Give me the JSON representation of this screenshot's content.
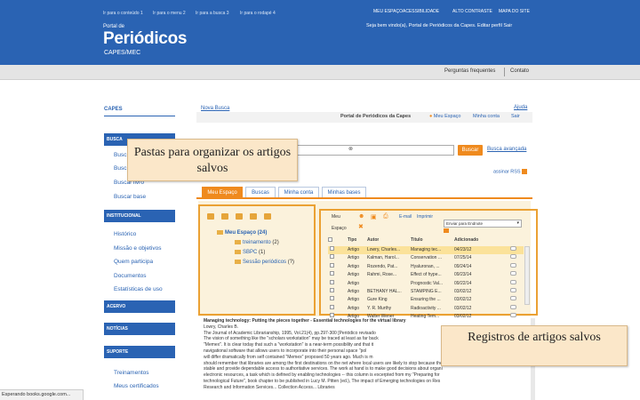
{
  "header": {
    "accessibility_links": [
      "Ir para o conteúdo 1",
      "Ir para o menu 2",
      "Ir para a busca 3",
      "Ir para o rodapé 4"
    ],
    "top_nav": [
      "MEU ESPAÇO",
      "ACESSIBILIDADE",
      "ALTO CONTRASTE",
      "MAPA DO SITE"
    ],
    "welcome": "Seja bem vindo(a), Portal de Periódicos da Capes. Editar perfil Sair",
    "brand_small": "Portal de",
    "brand_big": "Periódicos",
    "brand_sub": "CAPES/MEC"
  },
  "subnav": {
    "faq": "Perguntas frequentes",
    "contact": "Contato"
  },
  "sidebar": {
    "title": "CAPES",
    "sections": [
      "BUSCA",
      "INSTITUCIONAL",
      "ACERVO",
      "NOTÍCIAS",
      "SUPORTE"
    ],
    "busca_items": [
      "Busc",
      "Busc",
      "Buscar livro",
      "Buscar base"
    ],
    "institucional_items": [
      "Histórico",
      "Missão e objetivos",
      "Quem participa",
      "Documentos",
      "Estatísticas de uso"
    ],
    "suporte_items": [
      "Treinamentos",
      "Meus certificados"
    ]
  },
  "main": {
    "new_search": "Nova Busca",
    "help": "Ajuda",
    "portal_title": "Portal de Periódicos da Capes",
    "my_space": "Meu Espaço",
    "my_account": "Minha conta",
    "logout": "Sair",
    "search_button": "Buscar",
    "advanced_search": "Busca avançada",
    "rss": "assinar RSS",
    "tabs": [
      "Meu Espaço",
      "Buscas",
      "Minha conta",
      "Minhas bases"
    ]
  },
  "folders": {
    "root": "Meu Espaço (24)",
    "children": [
      {
        "name": "treinamento",
        "count": "(2)"
      },
      {
        "name": "SBPC",
        "count": "(1)"
      },
      {
        "name": "Sessão periódicos",
        "count": "(?)"
      }
    ]
  },
  "records": {
    "toolbar_menu": "Meu",
    "toolbar_email": "E-mail",
    "toolbar_print": "Imprimir",
    "toolbar_space": "Espaço",
    "select_placeholder": "Enviar para Endnote",
    "columns": [
      "Tipo",
      "Autor",
      "Título",
      "Adicionado"
    ],
    "rows": [
      {
        "type": "Artigo",
        "author": "Lowry, Charles...",
        "title": "Managing tec...",
        "date": "04/23/12",
        "highlight": true
      },
      {
        "type": "Artigo",
        "author": "Kalman, Harol...",
        "title": "Conservation ...",
        "date": "07/25/14",
        "highlight": false
      },
      {
        "type": "Artigo",
        "author": "Rozendo, Pat...",
        "title": "Hyaluronan, ...",
        "date": "09/24/14",
        "highlight": false
      },
      {
        "type": "Artigo",
        "author": "Rahmi, Rose...",
        "title": "Effect of hype...",
        "date": "09/23/14",
        "highlight": false
      },
      {
        "type": "Artigo",
        "author": "",
        "title": "Prognostic Val...",
        "date": "09/22/14",
        "highlight": false
      },
      {
        "type": "Artigo",
        "author": "BETHANY HAL...",
        "title": "STAMPING E...",
        "date": "03/02/12",
        "highlight": false
      },
      {
        "type": "Artigo",
        "author": "Gure King",
        "title": "Ensuring the ...",
        "date": "03/02/12",
        "highlight": false
      },
      {
        "type": "Artigo",
        "author": "Y. R. Murthy",
        "title": "Radioactivity ...",
        "date": "03/02/12",
        "highlight": false
      },
      {
        "type": "Artigo",
        "author": "Walter Wener",
        "title": "Heating Tem...",
        "date": "03/02/12",
        "highlight": false
      }
    ]
  },
  "abstract": {
    "title": "Managing technology: Putting the pieces together - Essential technologies for the virtual library",
    "lines": [
      "Lowry, Charles B.",
      "The Journal of Academic Librarianship, 1995, Vol.21(4), pp.297-300 [Periódico revisado",
      "The vision of something like the \"scholars workstation\" may be traced at least as far back",
      "\"Memex\". It is clear today that such a \"workstation\" is a near-term possibility and that it",
      "navigational software that allows users to incorporate into their personal space \"pol",
      "will differ dramatically from self contained \"Memex\" proposed 50 years ago. Much is m",
      "should remember that libraries are among the first destinations on the net where local users are likely to stop because the",
      "stable and provide dependable access to authoritative services. The work at hand is to make good decisions about organi",
      "electronic resources, a task which is defined by enabling technologies -- this column is excerpted from my \"Preparing for",
      "technological Future\", book chapter to be published in Lucy M. Pitten (ed.), The impact of Emerging technologies on Res",
      "Research and Information Services... Collection Access... Libraries"
    ]
  },
  "callouts": {
    "folders": "Pastas para organizar os artigos salvos",
    "records": "Registros de artigos salvos"
  },
  "statusbar": "Esperando books.google.com..."
}
